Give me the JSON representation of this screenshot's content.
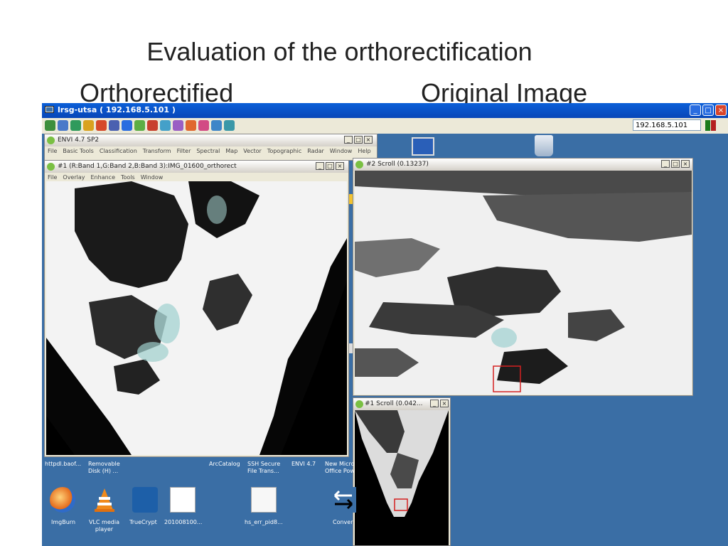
{
  "slide": {
    "title": "Evaluation of the orthorectification",
    "left_caption": "Orthorectified",
    "right_caption": "Original Image"
  },
  "remote_desktop": {
    "title": "lrsg-utsa ( 192.168.5.101 )",
    "address": "192.168.5.101",
    "buttons": {
      "minimize": "_",
      "maximize": "□",
      "close": "×"
    }
  },
  "envi_main": {
    "title": "ENVI 4.7 SP2",
    "menu": [
      "File",
      "Basic Tools",
      "Classification",
      "Transform",
      "Filter",
      "Spectral",
      "Map",
      "Vector",
      "Topographic",
      "Radar",
      "Window",
      "Help"
    ]
  },
  "image_window": {
    "title": "#1 (R:Band 1,G:Band 2,B:Band 3):IMG_01600_orthorect",
    "menu": [
      "File",
      "Overlay",
      "Enhance",
      "Tools",
      "Window"
    ]
  },
  "scroll_window_2": {
    "title": "#2 Scroll (0.13237)"
  },
  "scroll_window_1": {
    "title": "#1 Scroll (0.042..."
  },
  "desktop_icons_top": [
    {
      "label": "httpdl.baof..."
    },
    {
      "label": "Removable\nDisk (H) ..."
    },
    {
      "label": "ArcCatalog"
    },
    {
      "label": "SSH Secure\nFile Trans..."
    },
    {
      "label": "ENVI 4.7"
    },
    {
      "label": "New Micro\nOffice Pow"
    }
  ],
  "desktop_icons_bottom": [
    {
      "label": "ImgBurn"
    },
    {
      "label": "VLC media\nplayer"
    },
    {
      "label": "TrueCrypt"
    },
    {
      "label": "201008100..."
    },
    {
      "label": "hs_err_pid8..."
    },
    {
      "label": "Conver"
    }
  ]
}
